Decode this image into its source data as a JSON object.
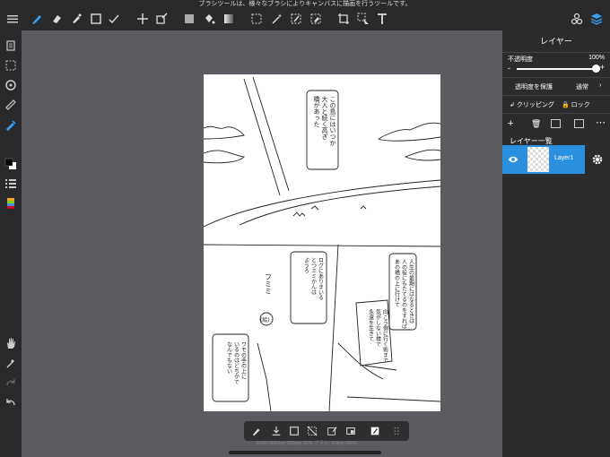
{
  "hint_text": "ブラシツールは、様々なブラシによりキャンバスに描画を行うツールです。",
  "accent_color": "#2b8fe0",
  "top_toolbar": {
    "icons": [
      "menu-icon",
      "brush-icon",
      "eraser-icon",
      "smudge-icon",
      "rect-icon",
      "pen-curve-icon",
      "move-icon",
      "transform-icon",
      "fill-color-icon",
      "bucket-icon",
      "gradient-icon",
      "select-rect-icon",
      "magic-wand-icon",
      "select-pen-icon",
      "select-eraser-icon",
      "crop-icon",
      "select-move-icon",
      "text-icon",
      "materials-icon",
      "layers-icon"
    ]
  },
  "layer_panel": {
    "title": "レイヤー",
    "opacity_label": "不透明度",
    "opacity_value": "100%",
    "opacity_fraction": 1.0,
    "minus": "-",
    "plus": "+",
    "protect_alpha": "透明度を保護",
    "blend_mode": "通常",
    "clipping": "クリッピング",
    "lock": "ロック",
    "list_title": "レイヤー一覧",
    "layers": [
      {
        "name": "Layer1",
        "selected": true
      }
    ]
  },
  "canvas_text": {
    "panel1_bubble": [
      "この島にはいつか",
      "大人と続く高ぎ",
      "橋があった"
    ],
    "panel2_bubble": [
      "ログにありまいる",
      "とつミミかんは",
      "ようろ"
    ],
    "panel2_sfx": "フミミ",
    "panel2_label": "(絵)",
    "panel3_bubble": [
      "人生の最期にはなるときは",
      "人の役にもたてるのをすれば",
      "あの橋の上に行けて"
    ],
    "panel3_note": [
      "向こう側に行く術まで",
      "気がしない様で",
      "永遠を生きて"
    ],
    "panel4_bubble": [
      "ワモの手の上に",
      "いるのはどちかで",
      "なんでもない"
    ]
  },
  "status_text": "2026*2664px 350dpi 32%  ブラシ: 5.0px 100%"
}
